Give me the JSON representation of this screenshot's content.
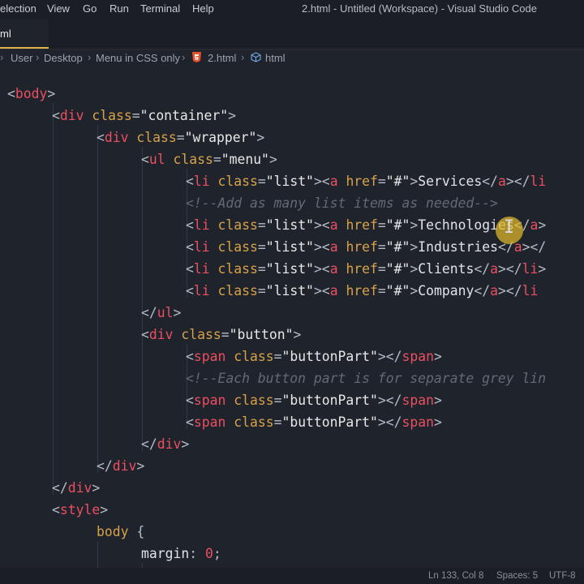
{
  "menubar": {
    "items": [
      "election",
      "View",
      "Go",
      "Run",
      "Terminal",
      "Help"
    ]
  },
  "window_title": "2.html - Untitled (Workspace) - Visual Studio Code",
  "tab": {
    "label": "ml"
  },
  "breadcrumb": {
    "items": [
      "User",
      "Desktop",
      "Menu in CSS only",
      "2.html",
      "html"
    ],
    "icons": [
      "html5-icon",
      "cube-icon"
    ]
  },
  "code": {
    "lines": [
      [
        "<",
        "body",
        ">"
      ],
      [
        "<",
        "div",
        " ",
        "class",
        "=",
        "\"container\"",
        ">"
      ],
      [
        "<",
        "div",
        " ",
        "class",
        "=",
        "\"wrapper\"",
        ">"
      ],
      [
        "<",
        "ul",
        " ",
        "class",
        "=",
        "\"menu\"",
        ">"
      ],
      [
        "<",
        "li",
        " ",
        "class",
        "=",
        "\"list\"",
        "><",
        "a",
        " ",
        "href",
        "=",
        "\"#\"",
        ">",
        "Services",
        "</",
        "a",
        "></",
        "li"
      ],
      [
        "<!--Add as many list items as needed-->"
      ],
      [
        "<",
        "li",
        " ",
        "class",
        "=",
        "\"list\"",
        "><",
        "a",
        " ",
        "href",
        "=",
        "\"#\"",
        ">",
        "Technologies",
        "</",
        "a",
        ">"
      ],
      [
        "<",
        "li",
        " ",
        "class",
        "=",
        "\"list\"",
        "><",
        "a",
        " ",
        "href",
        "=",
        "\"#\"",
        ">",
        "Industries",
        "</",
        "a",
        "></"
      ],
      [
        "<",
        "li",
        " ",
        "class",
        "=",
        "\"list\"",
        "><",
        "a",
        " ",
        "href",
        "=",
        "\"#\"",
        ">",
        "Clients",
        "</",
        "a",
        "></",
        "li",
        ">"
      ],
      [
        "<",
        "li",
        " ",
        "class",
        "=",
        "\"list\"",
        "><",
        "a",
        " ",
        "href",
        "=",
        "\"#\"",
        ">",
        "Company",
        "</",
        "a",
        "></",
        "li"
      ],
      [
        "</",
        "ul",
        ">"
      ],
      [
        "<",
        "div",
        " ",
        "class",
        "=",
        "\"button\"",
        ">"
      ],
      [
        "<",
        "span",
        " ",
        "class",
        "=",
        "\"buttonPart\"",
        "></",
        "span",
        ">"
      ],
      [
        "<!--Each button part is for separate grey lin"
      ],
      [
        "<",
        "span",
        " ",
        "class",
        "=",
        "\"buttonPart\"",
        "></",
        "span",
        ">"
      ],
      [
        "<",
        "span",
        " ",
        "class",
        "=",
        "\"buttonPart\"",
        "></",
        "span",
        ">"
      ],
      [
        "</",
        "div",
        ">"
      ],
      [
        "</",
        "div",
        ">"
      ],
      [
        "</",
        "div",
        ">"
      ],
      [
        "<",
        "style",
        ">"
      ],
      [
        "body",
        " {"
      ],
      [
        "margin",
        ": ",
        "0",
        ";"
      ]
    ]
  },
  "statusbar": {
    "position": "Ln 133, Col 8",
    "spaces": "Spaces: 5",
    "encoding": "UTF-8"
  },
  "colors": {
    "tag": "#ec4f62",
    "attribute": "#d8a24a",
    "string": "#e8e8e8",
    "comment": "#636a76",
    "cursor_highlight": "#e2ba2a"
  }
}
